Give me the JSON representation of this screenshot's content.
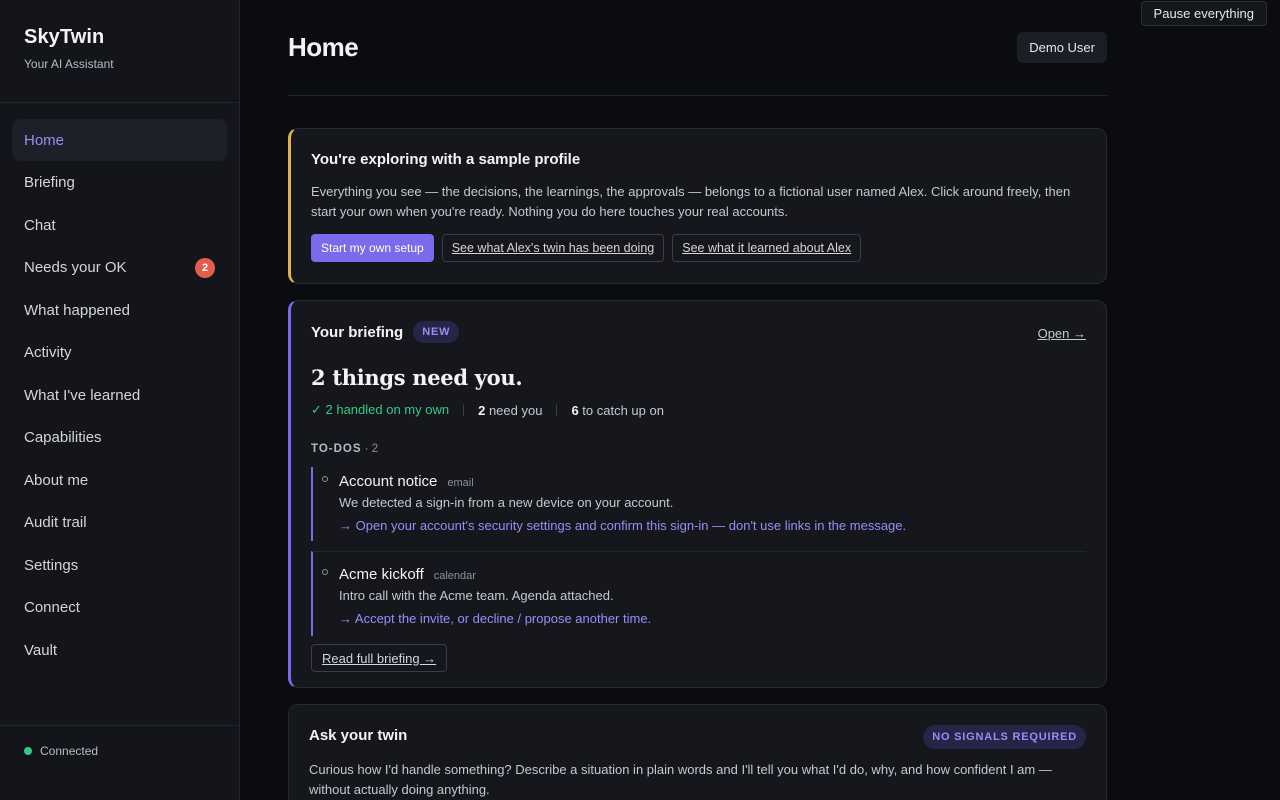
{
  "app": {
    "name": "SkyTwin",
    "tagline": "Your AI Assistant"
  },
  "sidebar": {
    "items": [
      {
        "label": "Home",
        "active": true
      },
      {
        "label": "Briefing"
      },
      {
        "label": "Chat"
      },
      {
        "label": "Needs your OK",
        "badge": "2"
      },
      {
        "label": "What happened"
      },
      {
        "label": "Activity"
      },
      {
        "label": "What I've learned"
      },
      {
        "label": "Capabilities"
      },
      {
        "label": "About me"
      },
      {
        "label": "Audit trail"
      },
      {
        "label": "Settings"
      },
      {
        "label": "Connect"
      },
      {
        "label": "Vault"
      }
    ],
    "status": "Connected"
  },
  "top": {
    "pause_label": "Pause everything"
  },
  "header": {
    "title": "Home",
    "user": "Demo User"
  },
  "sample": {
    "title": "You're exploring with a sample profile",
    "text": "Everything you see — the decisions, the learnings, the approvals — belongs to a fictional user named Alex. Click around freely, then start your own when you're ready. Nothing you do here touches your real accounts.",
    "primary_label": "Start my own setup",
    "twin_link": "See what Alex's twin has been doing",
    "learned_link": "See what it learned about Alex"
  },
  "briefing": {
    "title": "Your briefing",
    "badge": "NEW",
    "open_label": "Open →",
    "headline": "2 things need you.",
    "handled": "✓ 2 handled on my own",
    "need_count": "2",
    "need_label": " need you",
    "catchup_count": "6",
    "catchup_label": " to catch up on",
    "todos_label": "TO-DOS",
    "todos_count": " · 2",
    "todos": [
      {
        "title": "Account notice",
        "tag": "email",
        "desc": "We detected a sign-in from a new device on your account.",
        "action": "→ Open your account's security settings and confirm this sign-in — don't use links in the message."
      },
      {
        "title": "Acme kickoff",
        "tag": "calendar",
        "desc": "Intro call with the Acme team. Agenda attached.",
        "action": "→ Accept the invite, or decline / propose another time."
      }
    ],
    "read_full": "Read full briefing →"
  },
  "ask": {
    "title": "Ask your twin",
    "badge": "NO SIGNALS REQUIRED",
    "text": "Curious how I'd handle something? Describe a situation in plain words and I'll tell you what I'd do, why, and how confident I am — without actually doing anything."
  },
  "colors": {
    "accent": "#7a6bec",
    "warning_border": "#e1b24a",
    "success": "#37c884",
    "badge_red": "#e35d4b"
  }
}
